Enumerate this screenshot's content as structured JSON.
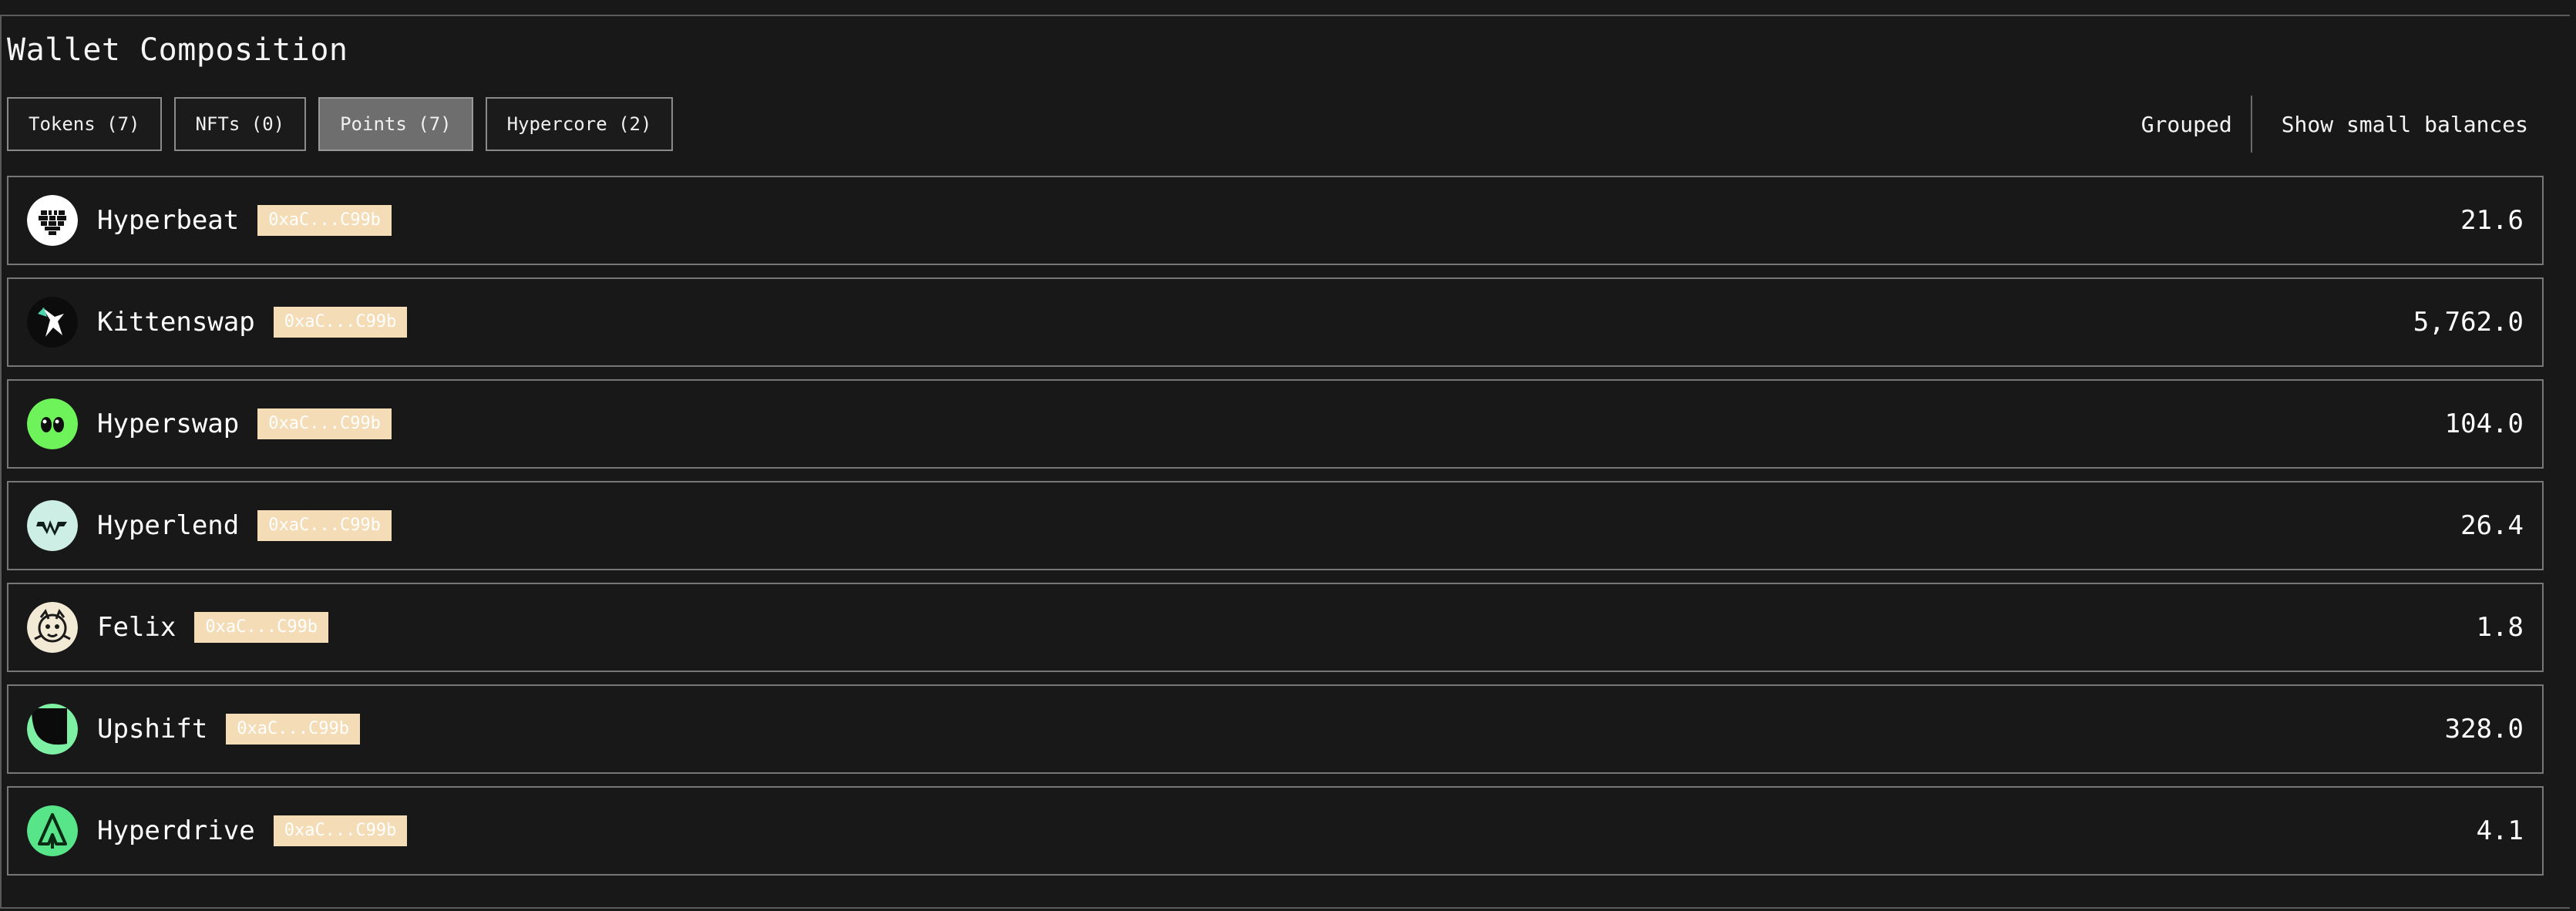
{
  "section": {
    "title": "Wallet Composition"
  },
  "tabs": [
    {
      "label": "Tokens (7)",
      "active": false
    },
    {
      "label": "NFTs (0)",
      "active": false
    },
    {
      "label": "Points (7)",
      "active": true
    },
    {
      "label": "Hypercore (2)",
      "active": false
    }
  ],
  "controls": {
    "grouped_label": "Grouped",
    "small_balances_label": "Show small balances"
  },
  "colors": {
    "background": "#181818",
    "active_tab": "#6e6e6e",
    "address_badge": "#f3dcb6"
  },
  "rows": [
    {
      "name": "Hyperbeat",
      "address": "0xaC...C99b",
      "value": "21.6",
      "icon": "hyperbeat-icon"
    },
    {
      "name": "Kittenswap",
      "address": "0xaC...C99b",
      "value": "5,762.0",
      "icon": "kittenswap-icon"
    },
    {
      "name": "Hyperswap",
      "address": "0xaC...C99b",
      "value": "104.0",
      "icon": "hyperswap-icon"
    },
    {
      "name": "Hyperlend",
      "address": "0xaC...C99b",
      "value": "26.4",
      "icon": "hyperlend-icon"
    },
    {
      "name": "Felix",
      "address": "0xaC...C99b",
      "value": "1.8",
      "icon": "felix-icon"
    },
    {
      "name": "Upshift",
      "address": "0xaC...C99b",
      "value": "328.0",
      "icon": "upshift-icon"
    },
    {
      "name": "Hyperdrive",
      "address": "0xaC...C99b",
      "value": "4.1",
      "icon": "hyperdrive-icon"
    }
  ]
}
